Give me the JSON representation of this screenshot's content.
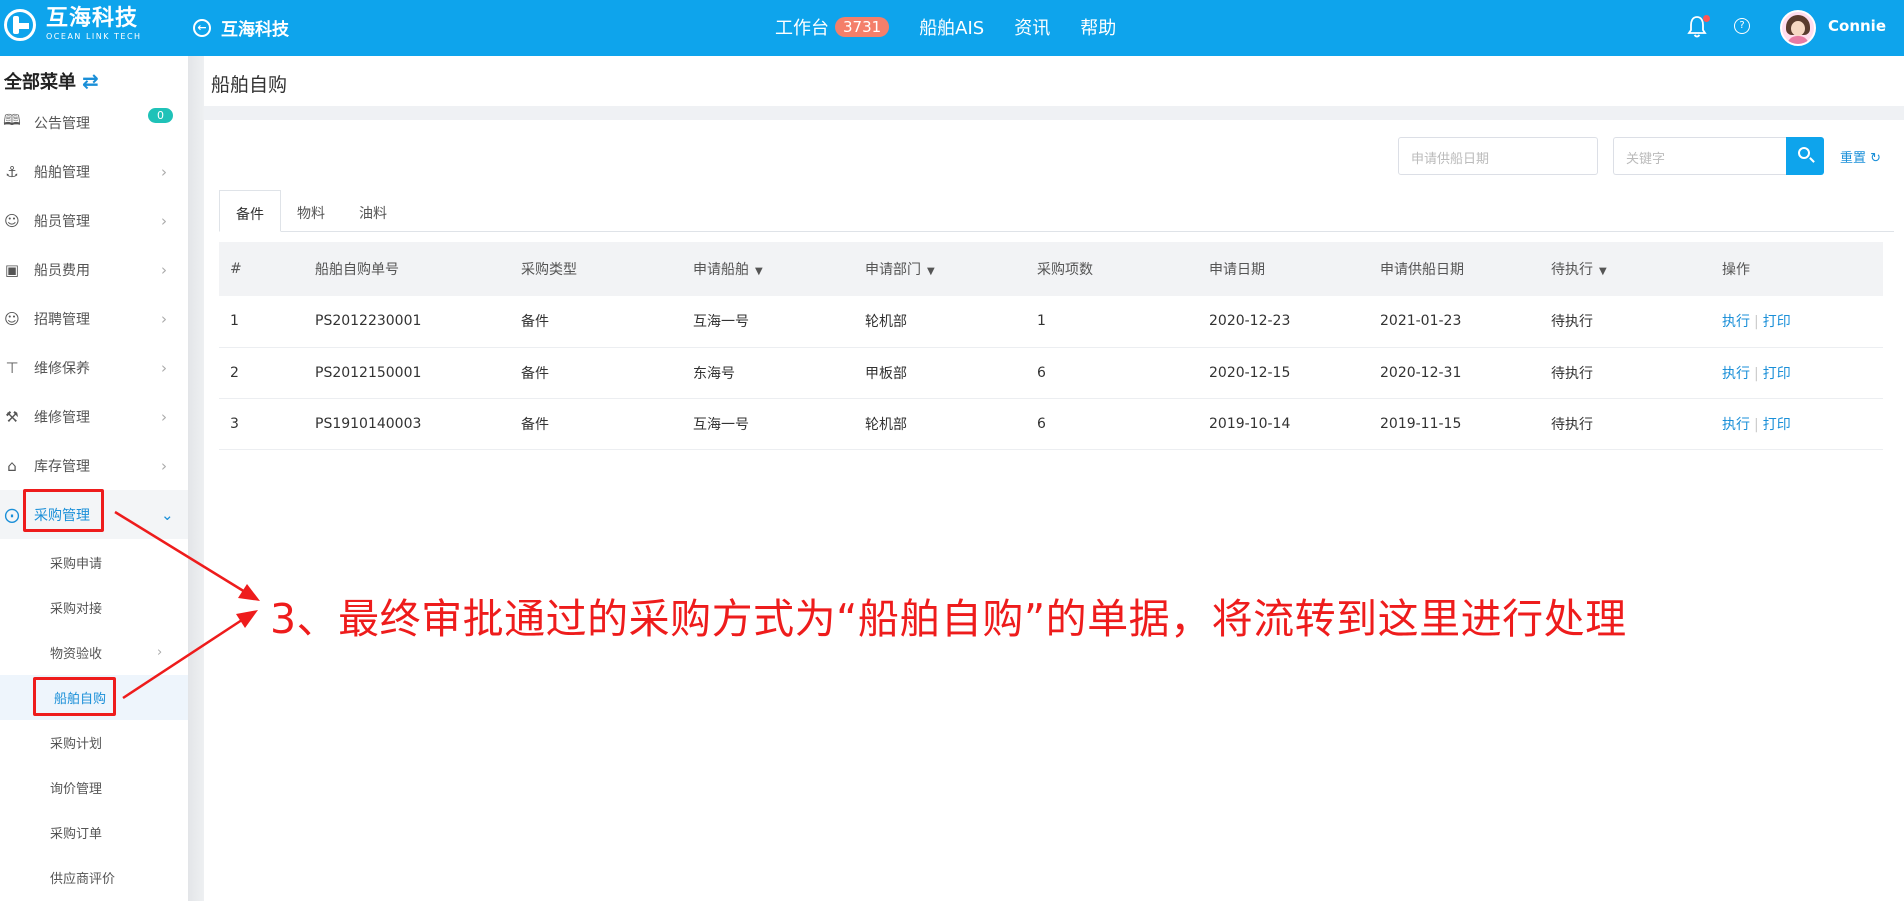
{
  "header": {
    "logo_cn": "互海科技",
    "logo_en": "OCEAN LINK TECH",
    "back_label": "互海科技",
    "nav": [
      {
        "label": "工作台",
        "badge": "3731"
      },
      {
        "label": "船舶AIS"
      },
      {
        "label": "资讯"
      },
      {
        "label": "帮助"
      }
    ],
    "username": "Connie"
  },
  "sidebar": {
    "title": "全部菜单",
    "notice_count": "0",
    "items": [
      {
        "label": "公告管理",
        "icon": "book-icon"
      },
      {
        "label": "船舶管理",
        "icon": "anchor-icon"
      },
      {
        "label": "船员管理",
        "icon": "person-icon"
      },
      {
        "label": "船员费用",
        "icon": "wallet-icon"
      },
      {
        "label": "招聘管理",
        "icon": "recruit-icon"
      },
      {
        "label": "维修保养",
        "icon": "hammer-icon"
      },
      {
        "label": "维修管理",
        "icon": "wrench-icon"
      },
      {
        "label": "库存管理",
        "icon": "home-icon"
      },
      {
        "label": "采购管理",
        "icon": "cart-icon"
      }
    ],
    "sub_items": [
      {
        "label": "采购申请"
      },
      {
        "label": "采购对接"
      },
      {
        "label": "物资验收"
      },
      {
        "label": "船舶自购"
      },
      {
        "label": "采购计划"
      },
      {
        "label": "询价管理"
      },
      {
        "label": "采购订单"
      },
      {
        "label": "供应商评价"
      }
    ]
  },
  "page": {
    "title": "船舶自购",
    "date_placeholder": "申请供船日期",
    "keyword_placeholder": "关键字",
    "reset_label": "重置",
    "tabs": [
      "备件",
      "物料",
      "油料"
    ],
    "columns": [
      "#",
      "船舶自购单号",
      "采购类型",
      "申请船舶",
      "申请部门",
      "采购项数",
      "申请日期",
      "申请供船日期",
      "待执行",
      "操作"
    ],
    "rows": [
      {
        "no": "1",
        "order": "PS2012230001",
        "type": "备件",
        "ship": "互海一号",
        "dept": "轮机部",
        "count": "1",
        "apply_date": "2020-12-23",
        "supply_date": "2021-01-23",
        "status": "待执行"
      },
      {
        "no": "2",
        "order": "PS2012150001",
        "type": "备件",
        "ship": "东海号",
        "dept": "甲板部",
        "count": "6",
        "apply_date": "2020-12-15",
        "supply_date": "2020-12-31",
        "status": "待执行"
      },
      {
        "no": "3",
        "order": "PS1910140003",
        "type": "备件",
        "ship": "互海一号",
        "dept": "轮机部",
        "count": "6",
        "apply_date": "2019-10-14",
        "supply_date": "2019-11-15",
        "status": "待执行"
      }
    ],
    "action_execute": "执行",
    "action_print": "打印"
  },
  "annotation": {
    "text": "3、最终审批通过的采购方式为“船舶自购”的单据，将流转到这里进行处理",
    "color": "#ee1c1c"
  },
  "colors": {
    "brand": "#0ea4ec",
    "link": "#1a8fd8"
  }
}
